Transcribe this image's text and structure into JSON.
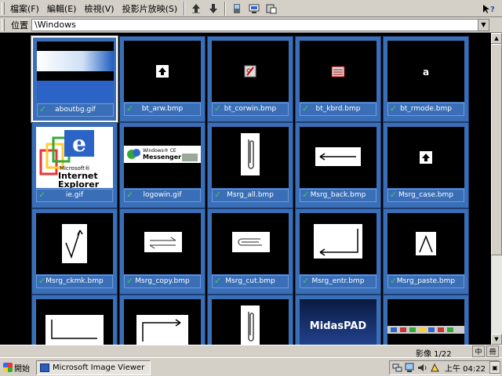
{
  "menu": {
    "items": [
      "檔案(F)",
      "編輯(E)",
      "檢視(V)",
      "投影片放映(S)"
    ],
    "toolbar_icons": [
      "arrow-up-icon",
      "arrow-down-icon",
      "phone-icon",
      "monitor-icon",
      "save-icon"
    ],
    "help_icon": "help-icon"
  },
  "address": {
    "label": "位置",
    "value": "\\Windows"
  },
  "thumbnails": [
    {
      "name": "aboutbg.gif",
      "icon": "gradient-banner-icon",
      "selected": true
    },
    {
      "name": "bt_arw.bmp",
      "icon": "arrow-up-icon"
    },
    {
      "name": "bt_corwin.bmp",
      "icon": "corwin-icon"
    },
    {
      "name": "bt_kbrd.bmp",
      "icon": "keyboard-icon"
    },
    {
      "name": "bt_rmode.bmp",
      "icon": "letter-a-icon"
    },
    {
      "name": "ie.gif",
      "icon": "internet-explorer-icon"
    },
    {
      "name": "logowin.gif",
      "icon": "messenger-icon"
    },
    {
      "name": "Msrg_all.bmp",
      "icon": "paperclip-icon"
    },
    {
      "name": "Msrg_back.bmp",
      "icon": "arrow-left-icon"
    },
    {
      "name": "Msrg_case.bmp",
      "icon": "arrow-up-icon"
    },
    {
      "name": "Msrg_ckmk.bmp",
      "icon": "checkmark-icon"
    },
    {
      "name": "Msrg_copy.bmp",
      "icon": "copy-icon"
    },
    {
      "name": "Msrg_cut.bmp",
      "icon": "cut-icon"
    },
    {
      "name": "Msrg_entr.bmp",
      "icon": "enter-icon"
    },
    {
      "name": "Msrg_paste.bmp",
      "icon": "caret-up-icon"
    },
    {
      "name": "",
      "icon": "corner-down-icon"
    },
    {
      "name": "",
      "icon": "corner-arrow-icon"
    },
    {
      "name": "",
      "icon": "paperclip-icon"
    },
    {
      "name": "",
      "icon": "midaspad-logo-icon",
      "text": "MidasPAD"
    },
    {
      "name": "",
      "icon": "icon-strip-icon"
    }
  ],
  "status": {
    "text": "影像 1/22",
    "ime_1": "中",
    "ime_2": "冊"
  },
  "taskbar": {
    "start_label": "開始",
    "task_label": "Microsoft Image Viewer",
    "clock": "上午 04:22"
  },
  "colors": {
    "tile_blue": "#3a6fb8",
    "label_border": "#6b9be0",
    "check_green": "#3cd43c"
  }
}
